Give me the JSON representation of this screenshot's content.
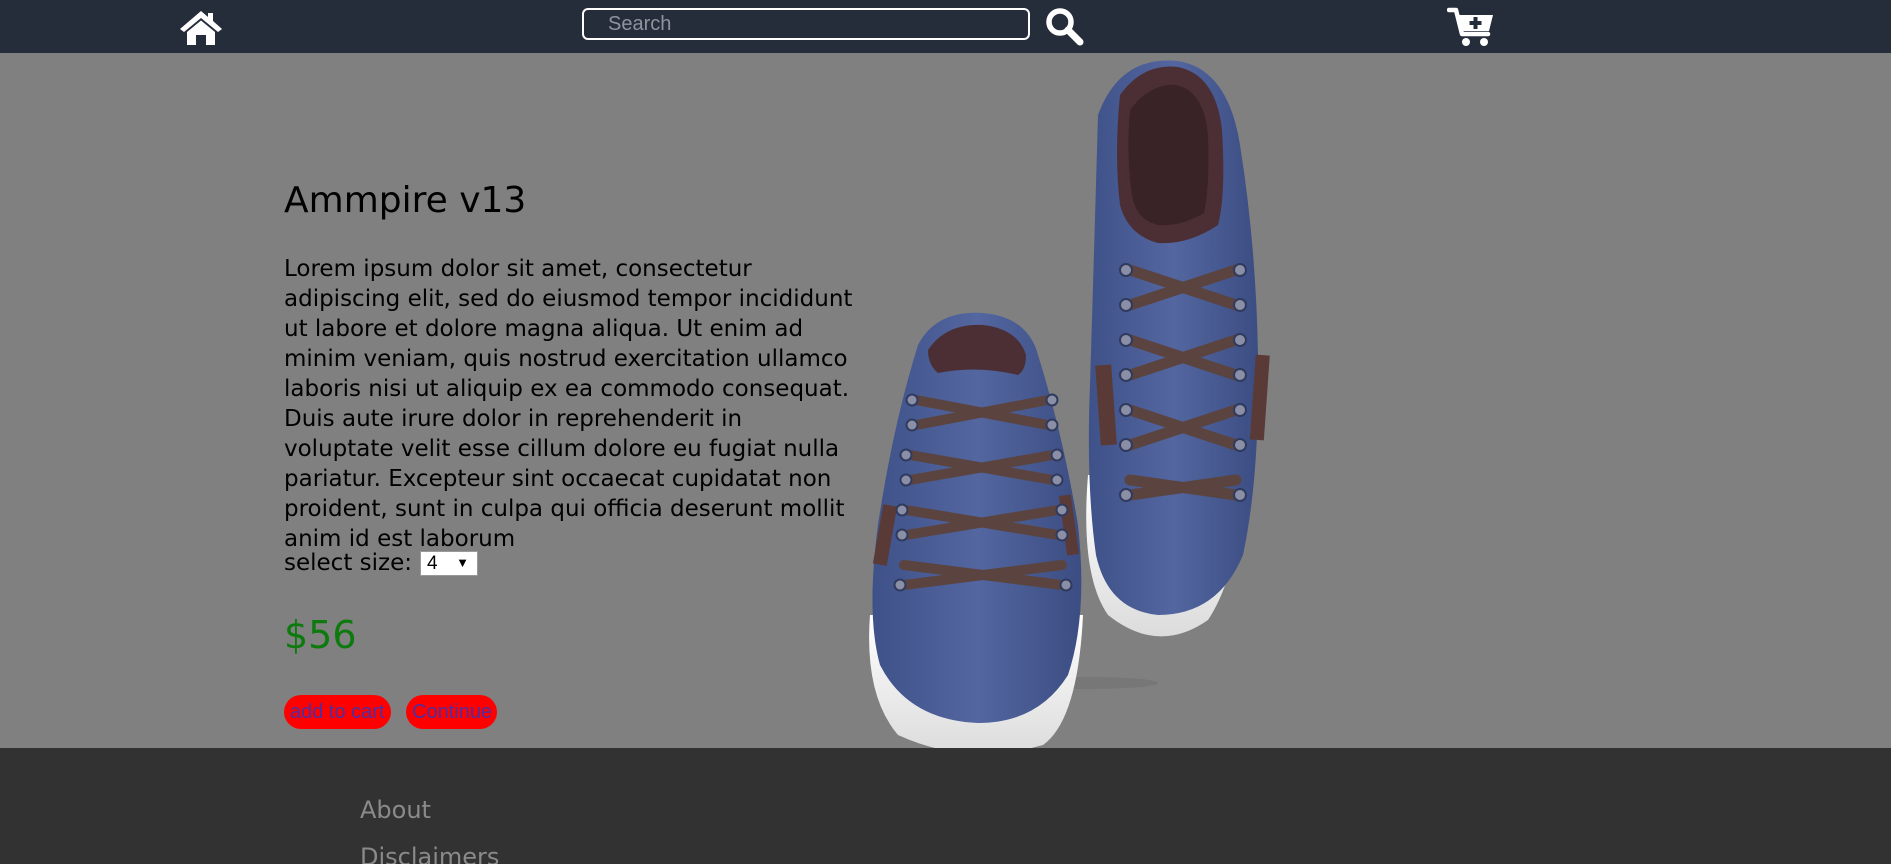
{
  "nav": {
    "search_placeholder": "Search",
    "icons": [
      "home-icon",
      "search-icon",
      "cart-plus-icon"
    ]
  },
  "product": {
    "title": "Ammpire v13",
    "description": "Lorem ipsum dolor sit amet, consectetur adipiscing elit, sed do eiusmod tempor incididunt ut labore et dolore magna aliqua. Ut enim ad minim veniam, quis nostrud exercitation ullamco laboris nisi ut aliquip ex ea commodo consequat. Duis aute irure dolor in reprehenderit in voluptate velit esse cillum dolore eu fugiat nulla pariatur. Excepteur sint occaecat cupidatat non proident, sunt in culpa qui officia deserunt mollit anim id est laborum",
    "size_label": "select size:",
    "size_value": "4",
    "price": "$56",
    "add_to_cart_label": "add to cart",
    "continue_label": "Continue",
    "image_subject": "pair of blue sneakers with brown laces"
  },
  "footer": {
    "links": [
      "About",
      "Disclaimers"
    ]
  },
  "colors": {
    "nav_bg": "#262d3a",
    "page_bg": "#808080",
    "footer_bg": "#323232",
    "price": "#0d7a0d",
    "button_bg": "#ff0000",
    "button_text": "#4b2fa3",
    "shoe_blue": "#4a5f94"
  }
}
